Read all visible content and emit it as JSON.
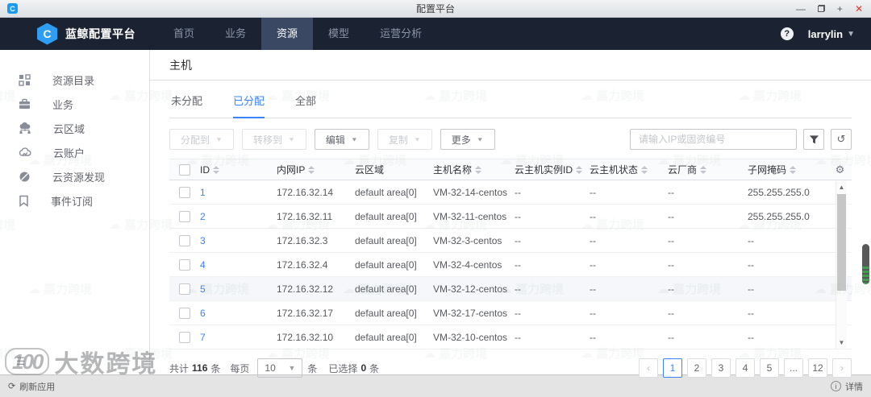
{
  "window": {
    "title": "配置平台",
    "app_initial": "C"
  },
  "navbar": {
    "brand": "蓝鲸配置平台",
    "brand_initial": "C",
    "items": [
      {
        "label": "首页",
        "active": false
      },
      {
        "label": "业务",
        "active": false
      },
      {
        "label": "资源",
        "active": true
      },
      {
        "label": "模型",
        "active": false
      },
      {
        "label": "运营分析",
        "active": false
      }
    ],
    "help_glyph": "?",
    "user": "larrylin"
  },
  "sidebar": {
    "items": [
      {
        "icon": "grid-icon",
        "label": "资源目录"
      },
      {
        "icon": "briefcase-icon",
        "label": "业务"
      },
      {
        "icon": "cloud-network-icon",
        "label": "云区域"
      },
      {
        "icon": "cloud-icon",
        "label": "云账户"
      },
      {
        "icon": "discover-icon",
        "label": "云资源发现"
      },
      {
        "icon": "bookmark-icon",
        "label": "事件订阅"
      }
    ]
  },
  "page": {
    "title": "主机",
    "tabs": [
      {
        "label": "未分配",
        "active": false
      },
      {
        "label": "已分配",
        "active": true
      },
      {
        "label": "全部",
        "active": false
      }
    ]
  },
  "toolbar": {
    "buttons": [
      {
        "label": "分配到",
        "enabled": false
      },
      {
        "label": "转移到",
        "enabled": false
      },
      {
        "label": "编辑",
        "enabled": true
      },
      {
        "label": "复制",
        "enabled": false
      },
      {
        "label": "更多",
        "enabled": true
      }
    ],
    "search_placeholder": "请输入IP或固资编号"
  },
  "table": {
    "columns": [
      {
        "label": "ID",
        "sortable": true
      },
      {
        "label": "内网IP",
        "sortable": true
      },
      {
        "label": "云区域",
        "sortable": false
      },
      {
        "label": "主机名称",
        "sortable": true
      },
      {
        "label": "云主机实例ID",
        "sortable": true
      },
      {
        "label": "云主机状态",
        "sortable": true
      },
      {
        "label": "云厂商",
        "sortable": true
      },
      {
        "label": "子网掩码",
        "sortable": true
      }
    ],
    "rows": [
      {
        "id": "1",
        "ip": "172.16.32.14",
        "region": "default area[0]",
        "hostname": "VM-32-14-centos",
        "instance_id": "--",
        "status": "--",
        "vendor": "--",
        "subnet_mask": "255.255.255.0",
        "highlighted": false
      },
      {
        "id": "2",
        "ip": "172.16.32.11",
        "region": "default area[0]",
        "hostname": "VM-32-11-centos",
        "instance_id": "--",
        "status": "--",
        "vendor": "--",
        "subnet_mask": "255.255.255.0",
        "highlighted": false
      },
      {
        "id": "3",
        "ip": "172.16.32.3",
        "region": "default area[0]",
        "hostname": "VM-32-3-centos",
        "instance_id": "--",
        "status": "--",
        "vendor": "--",
        "subnet_mask": "--",
        "highlighted": false
      },
      {
        "id": "4",
        "ip": "172.16.32.4",
        "region": "default area[0]",
        "hostname": "VM-32-4-centos",
        "instance_id": "--",
        "status": "--",
        "vendor": "--",
        "subnet_mask": "--",
        "highlighted": false
      },
      {
        "id": "5",
        "ip": "172.16.32.12",
        "region": "default area[0]",
        "hostname": "VM-32-12-centos",
        "instance_id": "--",
        "status": "--",
        "vendor": "--",
        "subnet_mask": "--",
        "highlighted": true
      },
      {
        "id": "6",
        "ip": "172.16.32.17",
        "region": "default area[0]",
        "hostname": "VM-32-17-centos",
        "instance_id": "--",
        "status": "--",
        "vendor": "--",
        "subnet_mask": "--",
        "highlighted": false
      },
      {
        "id": "7",
        "ip": "172.16.32.10",
        "region": "default area[0]",
        "hostname": "VM-32-10-centos",
        "instance_id": "--",
        "status": "--",
        "vendor": "--",
        "subnet_mask": "--",
        "highlighted": false
      }
    ]
  },
  "footer": {
    "total_label": "共计",
    "total_count": "116",
    "total_unit": "条",
    "per_page_label": "每页",
    "page_size": "10",
    "page_size_unit": "条",
    "selected_label": "已选择",
    "selected_count": "0",
    "selected_unit": "条"
  },
  "pagination": {
    "pages": [
      "1",
      "2",
      "3",
      "4",
      "5",
      "...",
      "12"
    ],
    "active_page": "1"
  },
  "statusbar": {
    "refresh_label": "刷新应用",
    "details_label": "详情"
  },
  "watermark": {
    "tile_text": "嘉力跨境",
    "logo_badge": "100",
    "logo_text": "大数跨境"
  },
  "colors": {
    "accent_blue": "#3a84ff",
    "navbar_bg": "#1b2332",
    "navbar_active_bg": "#3a4864",
    "close_red": "#e23b2e",
    "scroll_green": "#3fa04b"
  }
}
